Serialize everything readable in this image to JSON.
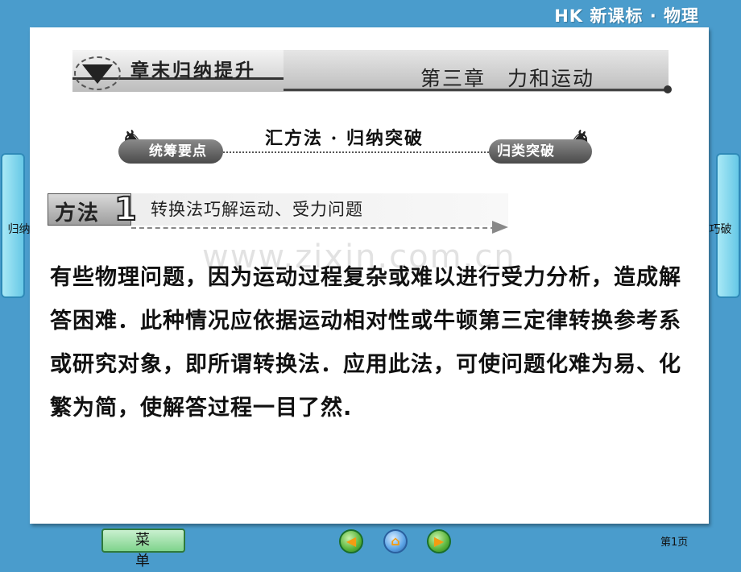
{
  "brand": "HK 新课标 · 物理",
  "chapter_header": {
    "tab_label": "章末归纳提升",
    "chapter_title": "第三章　力和运动"
  },
  "section_banner": {
    "title": "汇方法 · 归纳突破",
    "left_pill": "统筹要点",
    "right_pill": "归类突破"
  },
  "method": {
    "label": "方法",
    "number": "1",
    "title": "转换法巧解运动、受力问题"
  },
  "watermark": "www.zixin.com.cn",
  "body_text": "有些物理问题，因为运动过程复杂或难以进行受力分析，造成解答困难．此种情况应依据运动相对性或牛顿第三定律转换参考系或研究对象，即所谓转换法．应用此法，可使问题化难为易、化繁为简，使解答过程一目了然.",
  "side_tabs": {
    "left_label": "·归纳突",
    "right_label": "寻妙法·巧破"
  },
  "footer": {
    "menu_label": "菜单",
    "page_indicator": "第1页"
  },
  "colors": {
    "background": "#4a9ccc",
    "card": "#ffffff",
    "side_tab": "#66c8e6",
    "menu_button": "#7fd38c"
  }
}
